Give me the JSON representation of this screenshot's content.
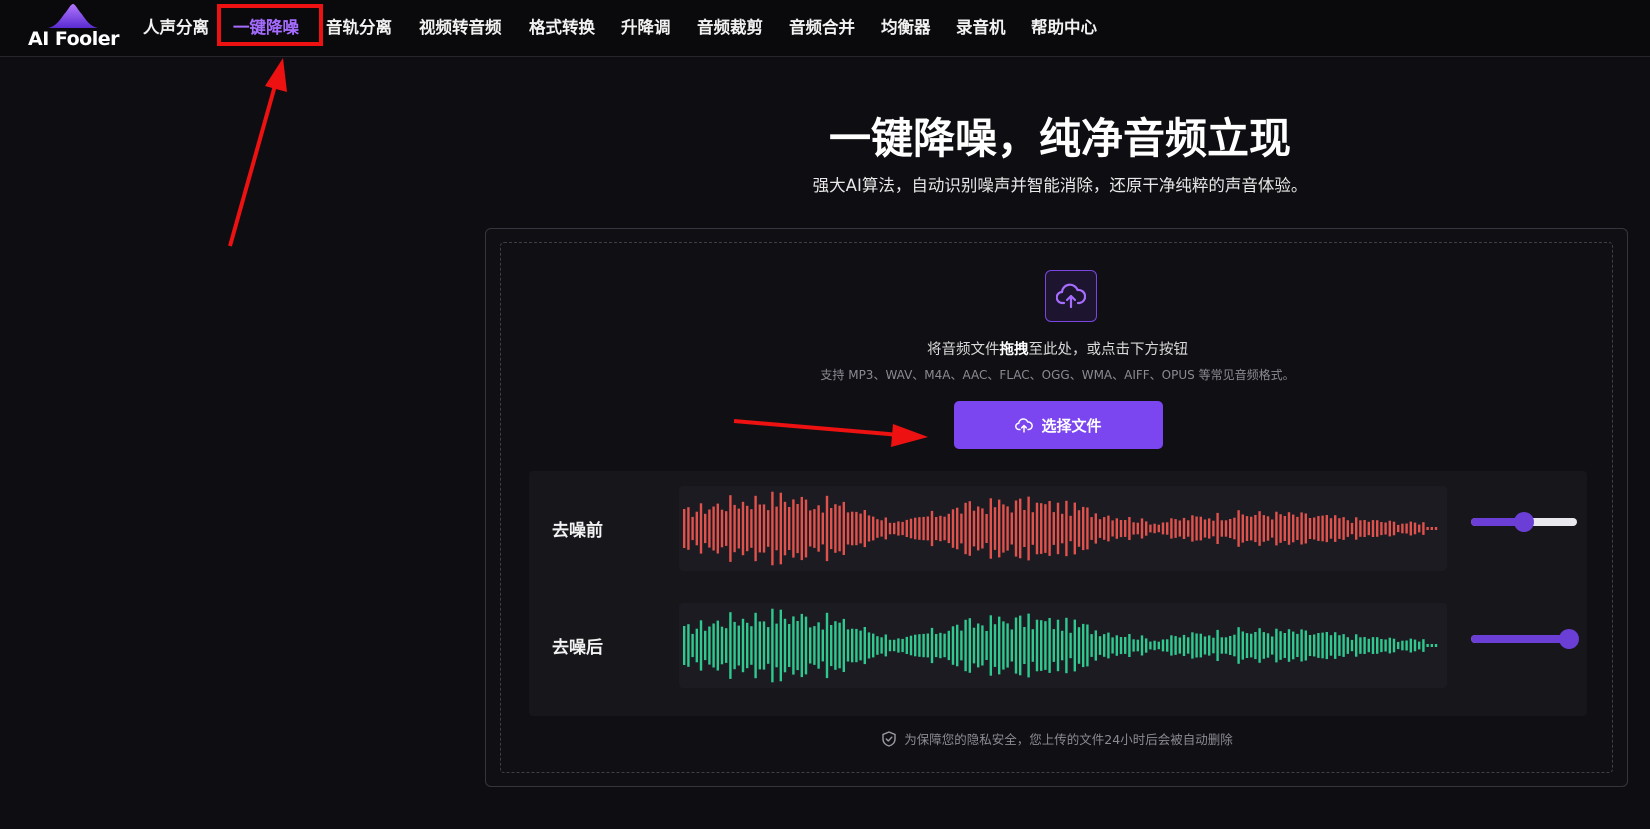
{
  "brand": {
    "name": "AI Fooler"
  },
  "nav": {
    "items": [
      {
        "label": "人声分离",
        "active": false
      },
      {
        "label": "一键降噪",
        "active": true
      },
      {
        "label": "音轨分离",
        "active": false
      },
      {
        "label": "视频转音频",
        "active": false
      },
      {
        "label": "格式转换",
        "active": false
      },
      {
        "label": "升降调",
        "active": false
      },
      {
        "label": "音频裁剪",
        "active": false
      },
      {
        "label": "音频合并",
        "active": false
      },
      {
        "label": "均衡器",
        "active": false
      },
      {
        "label": "录音机",
        "active": false
      },
      {
        "label": "帮助中心",
        "active": false
      }
    ]
  },
  "hero": {
    "title": "一键降噪，纯净音频立现",
    "subtitle": "强大AI算法，自动识别噪声并智能消除，还原干净纯粹的声音体验。"
  },
  "upload": {
    "icon": "cloud-upload-icon",
    "drop_prefix": "将音频文件",
    "drop_bold": "拖拽",
    "drop_suffix": "至此处，或点击下方按钮",
    "formats": "支持 MP3、WAV、M4A、AAC、FLAC、OGG、WMA、AIFF、OPUS 等常见音频格式。",
    "button_label": "选择文件"
  },
  "compare": {
    "rows": [
      {
        "label": "去噪前",
        "color": "#e0524b",
        "volume": 0.5
      },
      {
        "label": "去噪后",
        "color": "#2fc98f",
        "volume": 0.92
      }
    ]
  },
  "privacy": {
    "icon": "shield-check-icon",
    "text": "为保障您的隐私安全，您上传的文件24小时后会被自动删除"
  },
  "colors": {
    "accent": "#7b45ef",
    "annotation": "#ee1111"
  }
}
